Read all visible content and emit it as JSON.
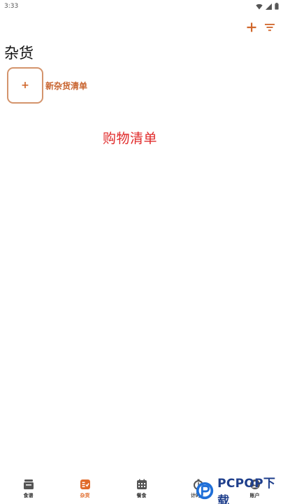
{
  "status_bar": {
    "time": "3:33"
  },
  "actions": {
    "add_icon": "plus-icon",
    "filter_icon": "filter-icon",
    "accent": "#d0662a"
  },
  "page": {
    "title": "杂货"
  },
  "new_list": {
    "plus": "+",
    "label": "新杂货清单"
  },
  "annotation": {
    "text": "购物清单",
    "color": "#e02a2a"
  },
  "bottom_nav": {
    "active_color": "#e06a2a",
    "items": [
      {
        "label": "食谱",
        "icon": "recipe-box-icon",
        "active": false
      },
      {
        "label": "杂货",
        "icon": "grocery-list-icon",
        "active": true
      },
      {
        "label": "餐食",
        "icon": "calendar-icon",
        "active": false
      },
      {
        "label": "计时器",
        "icon": "timer-icon",
        "active": false
      },
      {
        "label": "账户",
        "icon": "account-icon",
        "active": false
      }
    ]
  },
  "watermark": {
    "text": "PCPOP下载"
  }
}
